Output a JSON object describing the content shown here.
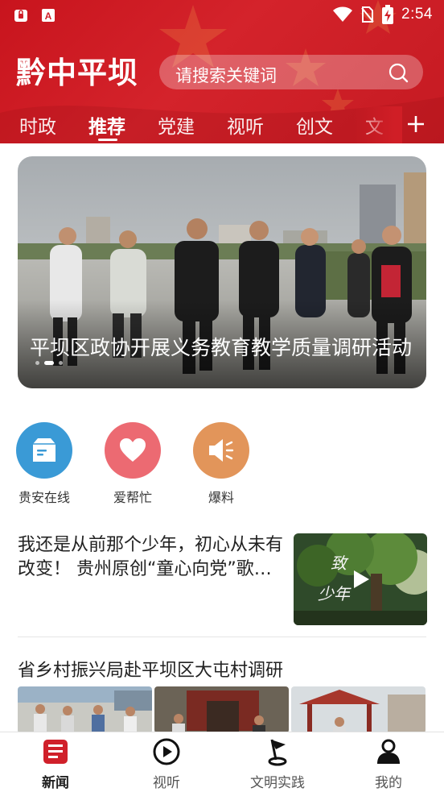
{
  "status_bar": {
    "time": "2:54",
    "left_icons": [
      "lock-notification-icon",
      "app-notification-icon"
    ],
    "right_icons": [
      "wifi-icon",
      "no-sim-icon",
      "battery-charging-icon"
    ]
  },
  "header": {
    "brand": "黔中平坝",
    "search_placeholder": "请搜索关键词",
    "search_icon": "search-icon",
    "tabs": [
      "时政",
      "推荐",
      "党建",
      "视听",
      "创文",
      "文"
    ],
    "active_tab": "推荐",
    "add_icon": "plus-icon"
  },
  "banner": {
    "title": "平坝区政协开展义务教育教学质量调研活动",
    "dots_count": 3,
    "active_dot": 1
  },
  "quick_actions": [
    {
      "label": "贵安在线",
      "icon": "box-icon",
      "color": "#3a9ad6"
    },
    {
      "label": "爱帮忙",
      "icon": "heart-icon",
      "color": "#ec6a72"
    },
    {
      "label": "爆料",
      "icon": "megaphone-icon",
      "color": "#e2955a"
    }
  ],
  "news": [
    {
      "title": "我还是从前那个少年，初心从未有改变！ 贵州原创“童心向党”歌曲《致少年》发布",
      "thumb_text": "致少年",
      "has_video": true
    },
    {
      "title": "省乡村振兴局赴平坝区大屯村调研"
    }
  ],
  "bottom_nav": [
    {
      "label": "新闻",
      "icon": "news-icon",
      "active": true
    },
    {
      "label": "视听",
      "icon": "play-circle-icon",
      "active": false
    },
    {
      "label": "文明实践",
      "icon": "flag-icon",
      "active": false
    },
    {
      "label": "我的",
      "icon": "user-icon",
      "active": false
    }
  ],
  "colors": {
    "brand_red": "#d0202a",
    "active_nav": "#d0202a"
  }
}
